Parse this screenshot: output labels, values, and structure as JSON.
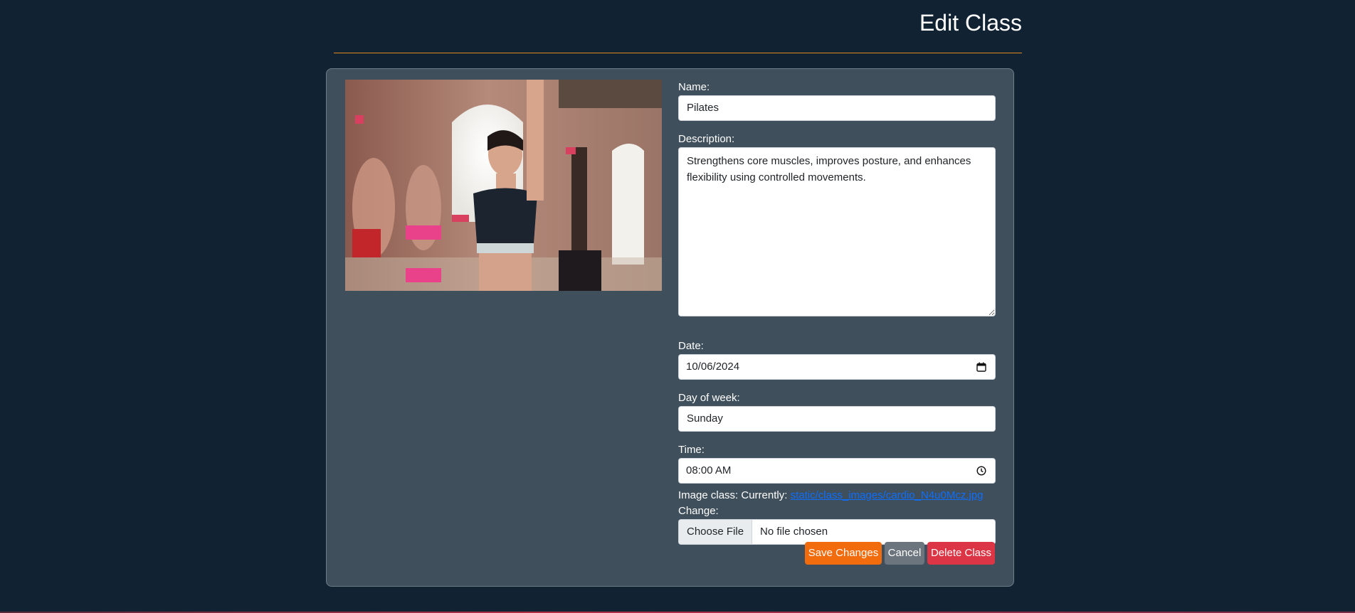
{
  "page": {
    "title": "Edit Class"
  },
  "colors": {
    "background": "#112233",
    "card": "#3f4f5c",
    "accent_rule": "#e08a1e",
    "save": "#f26b0c",
    "cancel": "#6c757d",
    "delete": "#dc3545",
    "link": "#0d6efd"
  },
  "image": {
    "alt_icon": "class-photo"
  },
  "form": {
    "name_label": "Name:",
    "name_value": "Pilates",
    "description_label": "Description:",
    "description_value": "Strengthens core muscles, improves posture, and enhances flexibility using controlled movements.",
    "date_label": "Date:",
    "date_value": "10/06/2024",
    "day_label": "Day of week:",
    "day_value": "Sunday",
    "time_label": "Time:",
    "time_value": "08:00 AM",
    "image_label": "Image class: Currently:",
    "image_current": "static/class_images/cardio_N4u0Mcz.jpg",
    "change_label": "Change:",
    "file_button": "Choose File",
    "file_status": "No file chosen"
  },
  "actions": {
    "save": "Save Changes",
    "cancel": "Cancel",
    "delete": "Delete Class"
  }
}
